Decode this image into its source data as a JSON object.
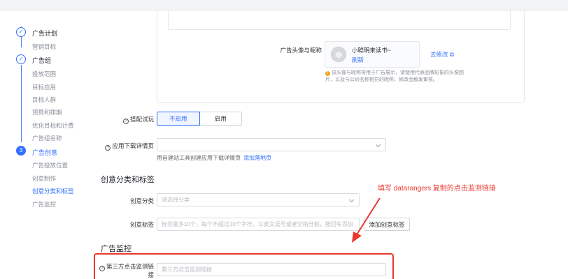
{
  "steps": {
    "step1": {
      "icon": "✓",
      "title": "广告计划",
      "items": [
        "营销目标"
      ]
    },
    "step2": {
      "icon": "✓",
      "title": "广告组",
      "items": [
        "投放范围",
        "目标应用",
        "目标人群",
        "预算和排期",
        "优化目标和计费",
        "广告组名称"
      ]
    },
    "step3": {
      "icon": "3",
      "title": "广告创意",
      "items": [
        "广告投放位置",
        "创意制作",
        "创意分类和标签",
        "广告监控"
      ]
    }
  },
  "avatar_section": {
    "label": "广告头像与昵称",
    "nickname": "小聪明来读书~",
    "refresh": "刷新",
    "edit_link": "去修改",
    "hint": "该头像与昵称将用于广告展示，请使用代表品牌形象的头像图片，以及与公司名称相符的昵称，修改会触发审核。"
  },
  "trial_play": {
    "label": "搭配试玩",
    "options": [
      "不启用",
      "启用"
    ],
    "selected": "不启用"
  },
  "download_page": {
    "label": "应用下载详情页",
    "placeholder": "",
    "helper": "用自建站工具创建应用下载详情页",
    "helper_link": "添加落地页"
  },
  "creative_section": {
    "title": "创意分类和标签",
    "category_label": "创意分类",
    "category_placeholder": "请选择分类",
    "tags_label": "创意标签",
    "tags_placeholder": "标签最多10个，每个不超过10个字符，以英文逗号或者空格分割，按回车添加",
    "add_tag_button": "添加创意标签"
  },
  "monitor_section": {
    "title": "广告监控",
    "click_label": "第三方点击监测链接",
    "click_placeholder": "第三方点击监测链接"
  },
  "annotation": "填写 datarangers 复制的点击监测链接",
  "colors": {
    "accent": "#3370ff",
    "annotation": "#e8392f"
  }
}
